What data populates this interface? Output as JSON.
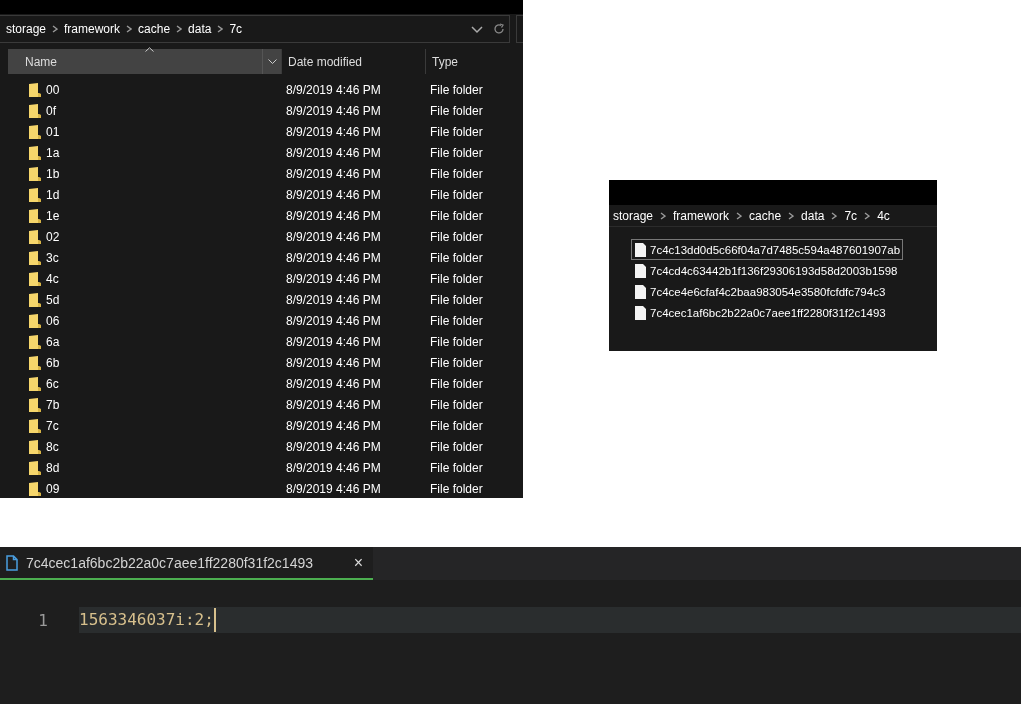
{
  "explorer": {
    "breadcrumb": [
      "storage",
      "framework",
      "cache",
      "data",
      "7c"
    ],
    "columns": [
      {
        "label": "Name",
        "sorted": true
      },
      {
        "label": "Date modified",
        "sorted": false
      },
      {
        "label": "Type",
        "sorted": false
      }
    ],
    "rows": [
      {
        "name": "00",
        "date": "8/9/2019 4:46 PM",
        "type": "File folder"
      },
      {
        "name": "0f",
        "date": "8/9/2019 4:46 PM",
        "type": "File folder"
      },
      {
        "name": "01",
        "date": "8/9/2019 4:46 PM",
        "type": "File folder"
      },
      {
        "name": "1a",
        "date": "8/9/2019 4:46 PM",
        "type": "File folder"
      },
      {
        "name": "1b",
        "date": "8/9/2019 4:46 PM",
        "type": "File folder"
      },
      {
        "name": "1d",
        "date": "8/9/2019 4:46 PM",
        "type": "File folder"
      },
      {
        "name": "1e",
        "date": "8/9/2019 4:46 PM",
        "type": "File folder"
      },
      {
        "name": "02",
        "date": "8/9/2019 4:46 PM",
        "type": "File folder"
      },
      {
        "name": "3c",
        "date": "8/9/2019 4:46 PM",
        "type": "File folder"
      },
      {
        "name": "4c",
        "date": "8/9/2019 4:46 PM",
        "type": "File folder"
      },
      {
        "name": "5d",
        "date": "8/9/2019 4:46 PM",
        "type": "File folder"
      },
      {
        "name": "06",
        "date": "8/9/2019 4:46 PM",
        "type": "File folder"
      },
      {
        "name": "6a",
        "date": "8/9/2019 4:46 PM",
        "type": "File folder"
      },
      {
        "name": "6b",
        "date": "8/9/2019 4:46 PM",
        "type": "File folder"
      },
      {
        "name": "6c",
        "date": "8/9/2019 4:46 PM",
        "type": "File folder"
      },
      {
        "name": "7b",
        "date": "8/9/2019 4:46 PM",
        "type": "File folder"
      },
      {
        "name": "7c",
        "date": "8/9/2019 4:46 PM",
        "type": "File folder"
      },
      {
        "name": "8c",
        "date": "8/9/2019 4:46 PM",
        "type": "File folder"
      },
      {
        "name": "8d",
        "date": "8/9/2019 4:46 PM",
        "type": "File folder"
      },
      {
        "name": "09",
        "date": "8/9/2019 4:46 PM",
        "type": "File folder"
      }
    ]
  },
  "explorer_2": {
    "breadcrumb": [
      "storage",
      "framework",
      "cache",
      "data",
      "7c",
      "4c"
    ],
    "files": [
      {
        "name": "7c4c13dd0d5c66f04a7d7485c594a487601907ab",
        "selected": true
      },
      {
        "name": "7c4cd4c63442b1f136f29306193d58d2003b1598",
        "selected": false
      },
      {
        "name": "7c4ce4e6cfaf4c2baa983054e3580fcfdfc794c3",
        "selected": false
      },
      {
        "name": "7c4cec1af6bc2b22a0c7aee1ff2280f31f2c1493",
        "selected": false
      }
    ]
  },
  "editor": {
    "tab": {
      "title": "7c4cec1af6bc2b22a0c7aee1ff2280f31f2c1493",
      "close": "×",
      "selected": true
    },
    "lines": [
      {
        "number": "1",
        "text": "1563346037i:2;"
      }
    ]
  }
}
